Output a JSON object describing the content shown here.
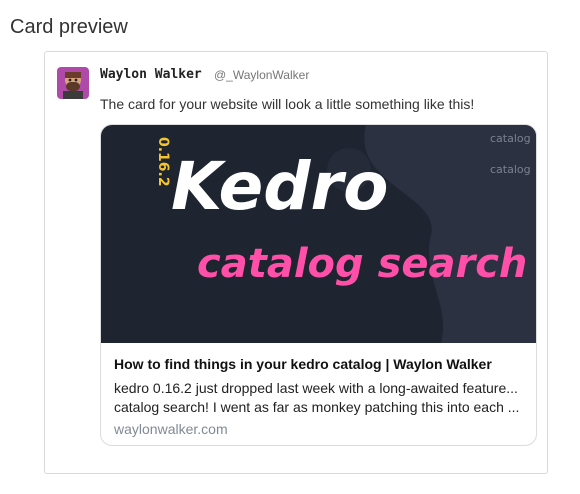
{
  "section_title": "Card preview",
  "tweet": {
    "author_name": "Waylon Walker",
    "author_handle": "@_WaylonWalker",
    "text": "The card for your website will look a little something like this!"
  },
  "card": {
    "image": {
      "version_label": "0.16.2",
      "brand_text": "Kedro",
      "subtitle_text": "catalog search",
      "side_text_1": "catalog",
      "side_text_2": "catalog",
      "background_color": "#1e2430",
      "accent_color": "#ff4fa8",
      "version_color": "#f2c531"
    },
    "title": "How to find things in your kedro catalog | Waylon Walker",
    "description_line1": "kedro 0.16.2 just dropped last week with a long-awaited feature...",
    "description_line2": "catalog search! I went as far as monkey patching this into each ...",
    "domain": "waylonwalker.com"
  }
}
